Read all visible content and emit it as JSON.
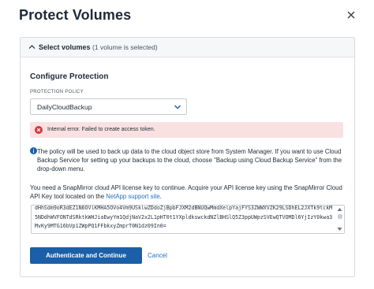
{
  "dialog": {
    "title": "Protect Volumes"
  },
  "section": {
    "title": "Select volumes",
    "subtitle": "(1 volume is selected)"
  },
  "configure": {
    "title": "Configure Protection",
    "policy_label": "PROTECTION POLICY",
    "policy_value": "DailyCloudBackup"
  },
  "error": {
    "message": "Internal error. Failed to create access token."
  },
  "info": {
    "text": "The policy will be used to back up data to the cloud object store from System Manager. If you want to use Cloud Backup Service for setting up your backups to the cloud, choose \"Backup using Cloud Backup Service\" from the drop-down menu."
  },
  "license": {
    "text_before": "You need a SnapMirror cloud API license key to continue. Acquire your API license key using the SnapMirror Cloud API Key tool located on the ",
    "link": "NetApp support site",
    "text_after": ".",
    "key_value": "dHhSdm9oR3dEZ1N6OVlKMHA5OVo4Vm9USklwZDdoZjBpbFJXM2dBNUQwMmdXelpYajFYS3ZWWXVZK29LSDhEL2JXTk9tckM5NDdhWVFONTdSRktkWHJiaEwyYm1QdjNaV2x2L1pHT0t1YXpldkswckdNZlBHSlQ5Z3ppUWpzSVEwQTVOMDl6YjIzY0kwa3MvKy9MTG16bVp1ZWpPQ1FFbkxyZmprT0N1dz09In0="
  },
  "buttons": {
    "primary": "Authenticate and Continue",
    "cancel": "Cancel"
  },
  "colors": {
    "primary": "#1a5fa8",
    "link": "#1f6fc2",
    "error_bg": "#f9e1e2",
    "error_icon": "#d9363e",
    "info_icon": "#1a5fa8"
  },
  "icons": {
    "close": "close-icon",
    "section_toggle": "chevron-up-icon",
    "select": "chevron-down-icon",
    "error": "error-icon",
    "info": "info-icon"
  }
}
